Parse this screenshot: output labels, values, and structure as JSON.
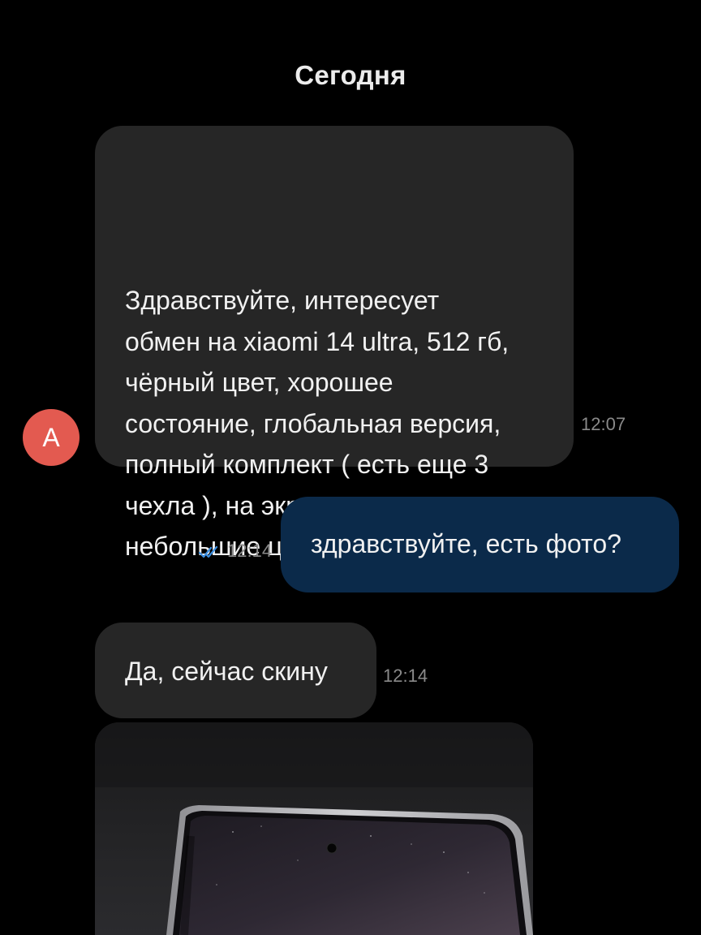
{
  "chat": {
    "date_header": "Сегодня",
    "sender_avatar_letter": "A",
    "messages": [
      {
        "direction": "incoming",
        "text": "Здравствуйте, интересует\nобмен на xiaomi 14 ultra, 512 гб,\nчёрный цвет, хорошее\nсостояние, глобальная версия,\nполный комплект ( есть еще 3\nчехла ), на экране есть\nнебольшие царапины.",
        "time": "12:07"
      },
      {
        "direction": "outgoing",
        "text": "здравствуйте, есть фото?",
        "time": "12:14",
        "status": "read"
      },
      {
        "direction": "incoming",
        "text": "Да, сейчас скину",
        "time": "12:14"
      },
      {
        "direction": "incoming",
        "type": "photo",
        "icon": "phone-photo"
      }
    ]
  },
  "colors": {
    "background": "#000000",
    "incoming_bubble": "#262626",
    "outgoing_bubble": "#0b2a4a",
    "avatar": "#e35a50",
    "read_check": "#3d8fe0"
  }
}
